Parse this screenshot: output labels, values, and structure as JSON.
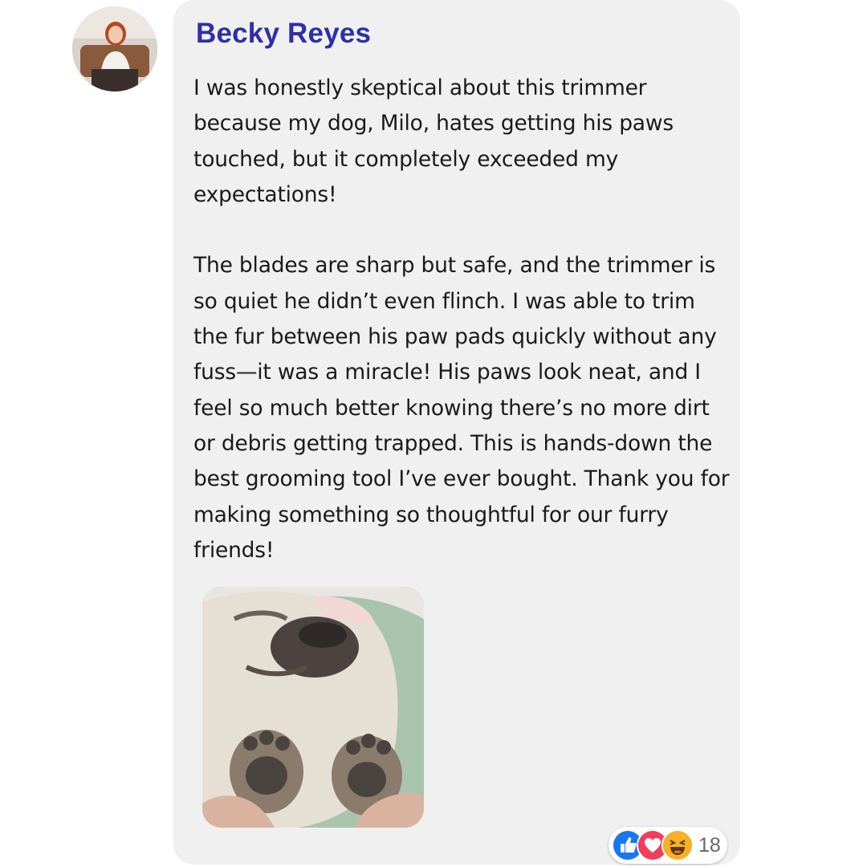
{
  "comment": {
    "author": "Becky Reyes",
    "paragraphs": [
      "I was honestly skeptical about this trimmer because my dog, Milo, hates getting his paws touched, but it completely exceeded my expectations!",
      "The blades are sharp but safe, and the trimmer is so quiet he didn’t even flinch. I was able to trim the fur between his paw pads quickly without any fuss—it was a miracle! His paws look neat, and I feel so much better knowing there’s no more dirt or debris getting trapped. This is hands-down the best grooming tool I’ve ever bought. Thank you for making something so thoughtful for our furry friends!"
    ],
    "reactions": {
      "icons": [
        "like-icon",
        "love-icon",
        "haha-icon"
      ],
      "count": "18"
    }
  },
  "colors": {
    "author_name": "#2f2fa6",
    "bubble_background": "#f0f0f0",
    "like": "#1877f2",
    "love": "#f33e58",
    "haha": "#f7b125"
  }
}
